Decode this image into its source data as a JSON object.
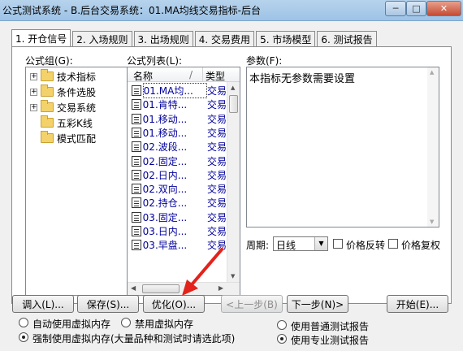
{
  "window": {
    "title": "公式测试系统 - B.后台交易系统：01.MA均线交易指标-后台",
    "min_symbol": "─",
    "max_symbol": "□",
    "close_symbol": "✕"
  },
  "tabs": [
    "1. 开仓信号",
    "2. 入场规则",
    "3. 出场规则",
    "4. 交易费用",
    "5. 市场模型",
    "6. 测试报告"
  ],
  "formula_group": {
    "label": "公式组(G):",
    "items": [
      {
        "label": "技术指标",
        "expander": "+"
      },
      {
        "label": "条件选股",
        "expander": "+"
      },
      {
        "label": "交易系统",
        "expander": "+"
      },
      {
        "label": "五彩K线",
        "expander": ""
      },
      {
        "label": "模式匹配",
        "expander": ""
      }
    ]
  },
  "formula_list": {
    "label": "公式列表(L):",
    "columns": {
      "name": "名称",
      "sort": "/",
      "type": "类型"
    },
    "rows": [
      {
        "name": "01.MA均...",
        "type": "交易",
        "selected": true
      },
      {
        "name": "01.肯特...",
        "type": "交易"
      },
      {
        "name": "01.移动...",
        "type": "交易"
      },
      {
        "name": "01.移动...",
        "type": "交易"
      },
      {
        "name": "02.波段...",
        "type": "交易"
      },
      {
        "name": "02.固定...",
        "type": "交易"
      },
      {
        "name": "02.日内...",
        "type": "交易"
      },
      {
        "name": "02.双向...",
        "type": "交易"
      },
      {
        "name": "02.持仓...",
        "type": "交易"
      },
      {
        "name": "03.固定...",
        "type": "交易"
      },
      {
        "name": "03.日内...",
        "type": "交易"
      },
      {
        "name": "03.早盘...",
        "type": "交易"
      }
    ]
  },
  "params": {
    "label": "参数(F):",
    "text": "本指标无参数需要设置"
  },
  "period": {
    "label": "周期:",
    "value": "日线",
    "price_reverse": "价格反转",
    "price_restore": "价格复权"
  },
  "buttons": {
    "load": "调入(L)...",
    "save": "保存(S)...",
    "optimize": "优化(O)...",
    "prev": "<上一步(B)",
    "next": "下一步(N)>",
    "start": "开始(E)..."
  },
  "memory_options": [
    {
      "label": "自动使用虚拟内存",
      "selected": false
    },
    {
      "label": "禁用虚拟内存",
      "selected": false
    },
    {
      "label": "强制使用虚拟内存(大量品种和测试时请选此项)",
      "selected": true
    }
  ],
  "report_options": [
    {
      "label": "使用普通测试报告",
      "selected": false
    },
    {
      "label": "使用专业测试报告",
      "selected": true
    }
  ],
  "colors": {
    "arrow": "#e3221b",
    "link_text": "#00009c"
  }
}
